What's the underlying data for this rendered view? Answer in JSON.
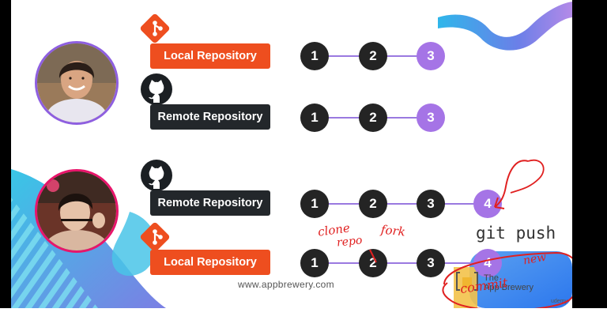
{
  "colors": {
    "local_pill": "#ee4e1f",
    "remote_pill": "#23272b",
    "node_dark": "#242424",
    "node_accent": "#a574e6",
    "connector": "#9a79e0",
    "annotation_ink": "#e02020",
    "avatar1_ring": "#8e5fe0",
    "avatar2_ring": "#e8156b"
  },
  "icons": {
    "git": "git-logo-icon",
    "github": "github-octocat-icon"
  },
  "top_section": {
    "local_label": "Local Repository",
    "remote_label": "Remote Repository",
    "local_nodes": [
      "1",
      "2",
      "3"
    ],
    "remote_nodes": [
      "1",
      "2",
      "3"
    ]
  },
  "bottom_section": {
    "remote_label": "Remote Repository",
    "local_label": "Local Repository",
    "remote_nodes": [
      "1",
      "2",
      "3",
      "4"
    ],
    "local_nodes": [
      "1",
      "2",
      "3",
      "4"
    ]
  },
  "command": "git push",
  "footer_url": "www.appbrewery.com",
  "logo": {
    "line1": "The",
    "line2": "App Brewery",
    "sub": "udemy"
  },
  "handwriting": {
    "note1": "clone",
    "note2": "repo",
    "note3": "fork",
    "note4": "new",
    "note5": "commit"
  }
}
